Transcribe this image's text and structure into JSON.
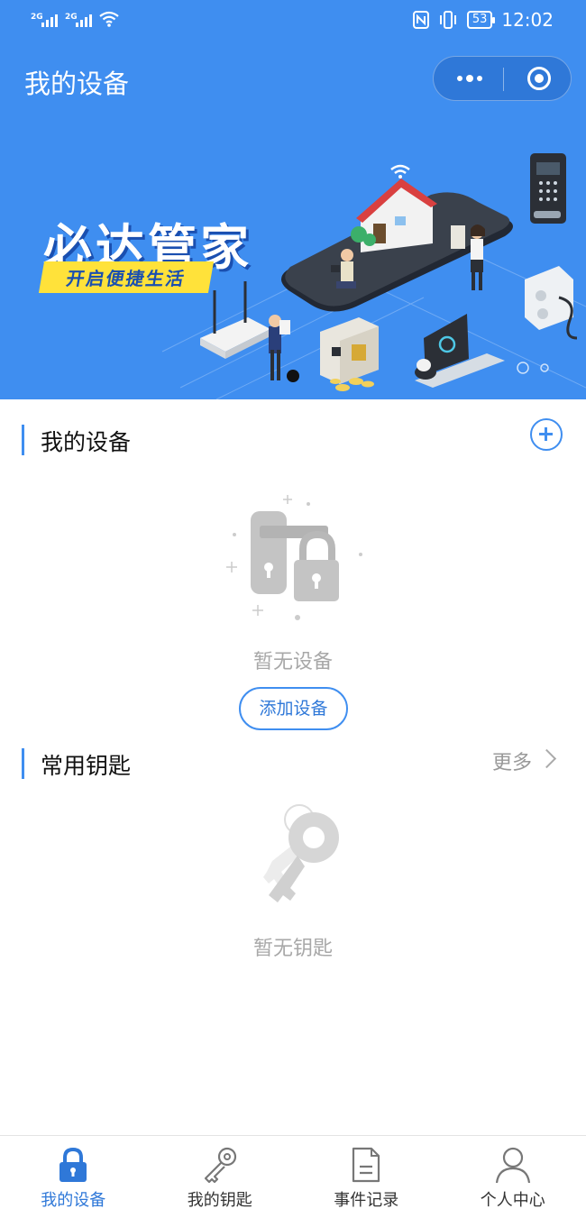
{
  "status_bar": {
    "net1": "2G",
    "net2": "2G",
    "battery": "53",
    "time": "12:02"
  },
  "header": {
    "title": "我的设备"
  },
  "banner": {
    "title": "必达管家",
    "subtitle": "开启便捷生活"
  },
  "devices": {
    "title": "我的设备",
    "empty_text": "暂无设备",
    "add_button": "添加设备"
  },
  "keys": {
    "title": "常用钥匙",
    "more": "更多",
    "empty_text": "暂无钥匙"
  },
  "tabbar": {
    "items": [
      {
        "label": "我的设备",
        "icon": "lock-icon",
        "active": true
      },
      {
        "label": "我的钥匙",
        "icon": "key-icon",
        "active": false
      },
      {
        "label": "事件记录",
        "icon": "document-icon",
        "active": false
      },
      {
        "label": "个人中心",
        "icon": "person-icon",
        "active": false
      }
    ]
  },
  "colors": {
    "primary": "#3f8ef0",
    "primary_dark": "#2f78d8",
    "banner_accent": "#ffe23a"
  }
}
